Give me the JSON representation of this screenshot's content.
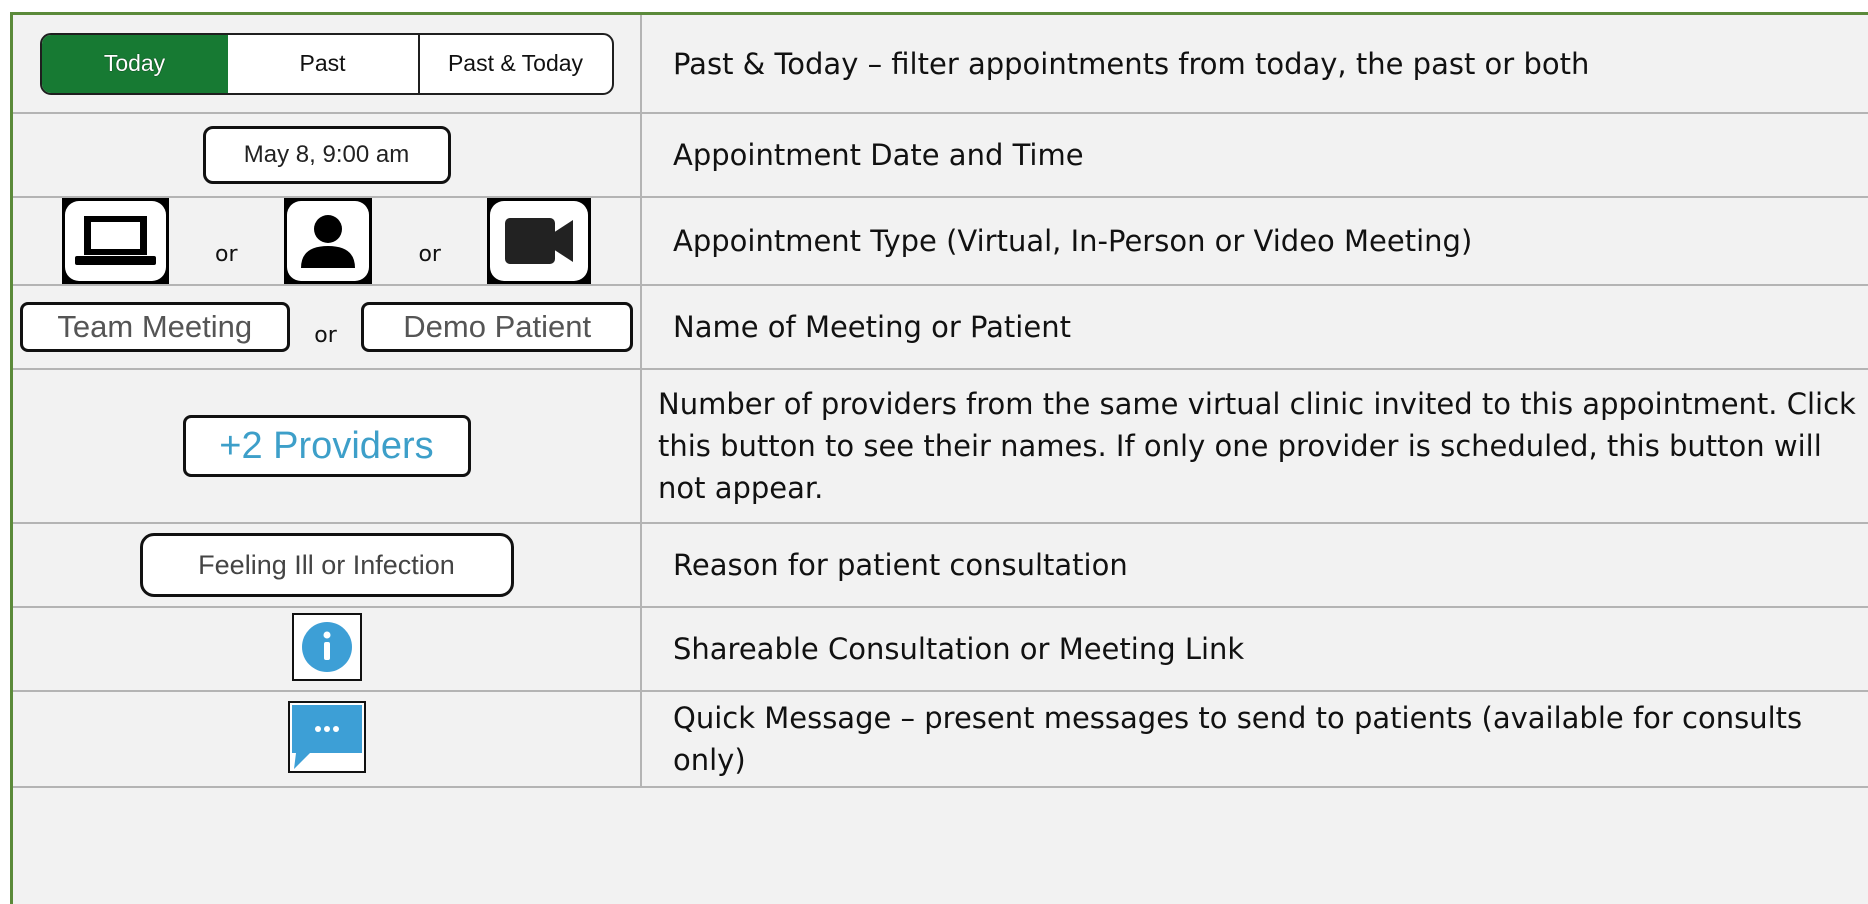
{
  "rows": [
    {
      "segments": [
        "Today",
        "Past",
        "Past & Today"
      ],
      "description": "Past & Today – filter appointments from today, the past or both"
    },
    {
      "date_label": "May 8, 9:00 am",
      "description": "Appointment Date and Time"
    },
    {
      "icons": [
        "laptop-icon",
        "person-icon",
        "video-camera-icon"
      ],
      "separator": "or",
      "description": "Appointment Type (Virtual, In-Person or Video Meeting)"
    },
    {
      "names": [
        "Team Meeting",
        "Demo Patient"
      ],
      "separator": "or",
      "description": "Name of Meeting or Patient"
    },
    {
      "button_label": "+2 Providers",
      "description": "Number of providers from the same virtual clinic invited to this appointment.  Click this button to see their names. If only one provider is scheduled, this button will not appear."
    },
    {
      "reason_label": "Feeling Ill or Infection",
      "description": "Reason for patient consultation"
    },
    {
      "icon": "info-icon",
      "description": "Shareable Consultation or Meeting Link"
    },
    {
      "icon": "message-icon",
      "description": "Quick Message – present messages to send to patients (available for consults only)"
    }
  ],
  "colors": {
    "border": "#5b8a3a",
    "active_segment": "#177a33",
    "accent_blue": "#3d9fc9",
    "cell_bg": "#f2f2f2"
  }
}
